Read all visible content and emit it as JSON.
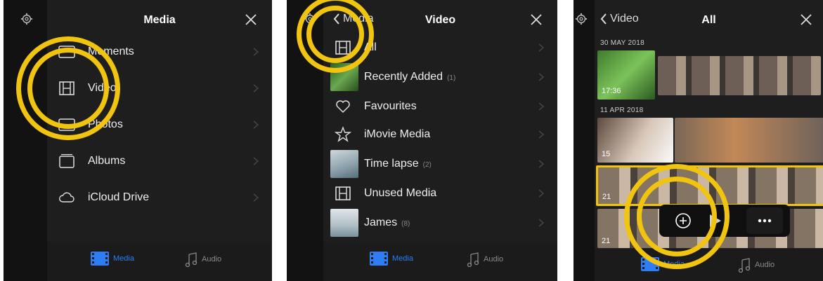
{
  "panel1": {
    "title": "Media",
    "items": [
      {
        "label": "Moments"
      },
      {
        "label": "Video"
      },
      {
        "label": "Photos"
      },
      {
        "label": "Albums"
      },
      {
        "label": "iCloud Drive"
      }
    ],
    "tabs": [
      {
        "label": "Media"
      },
      {
        "label": "Audio"
      }
    ]
  },
  "panel2": {
    "title": "Video",
    "back_label": "Media",
    "items": [
      {
        "label": "All",
        "count": ""
      },
      {
        "label": "Recently Added",
        "count": "(1)"
      },
      {
        "label": "Favourites",
        "count": ""
      },
      {
        "label": "iMovie Media",
        "count": ""
      },
      {
        "label": "Time lapse",
        "count": "(2)"
      },
      {
        "label": "Unused Media",
        "count": ""
      },
      {
        "label": "James",
        "count": "(8)"
      }
    ],
    "tabs": [
      {
        "label": "Media"
      },
      {
        "label": "Audio"
      }
    ]
  },
  "panel3": {
    "title": "All",
    "back_label": "Video",
    "sections": [
      {
        "date": "30 MAY 2018",
        "duration": "17:36"
      },
      {
        "date": "11 APR 2018",
        "durations": [
          "15",
          "21",
          "21"
        ]
      }
    ],
    "tabs": [
      {
        "label": "Media"
      },
      {
        "label": "Audio"
      }
    ]
  },
  "colors": {
    "accent": "#2e7cf6",
    "highlight": "#f1c40f",
    "background": "#1e1e1e"
  }
}
